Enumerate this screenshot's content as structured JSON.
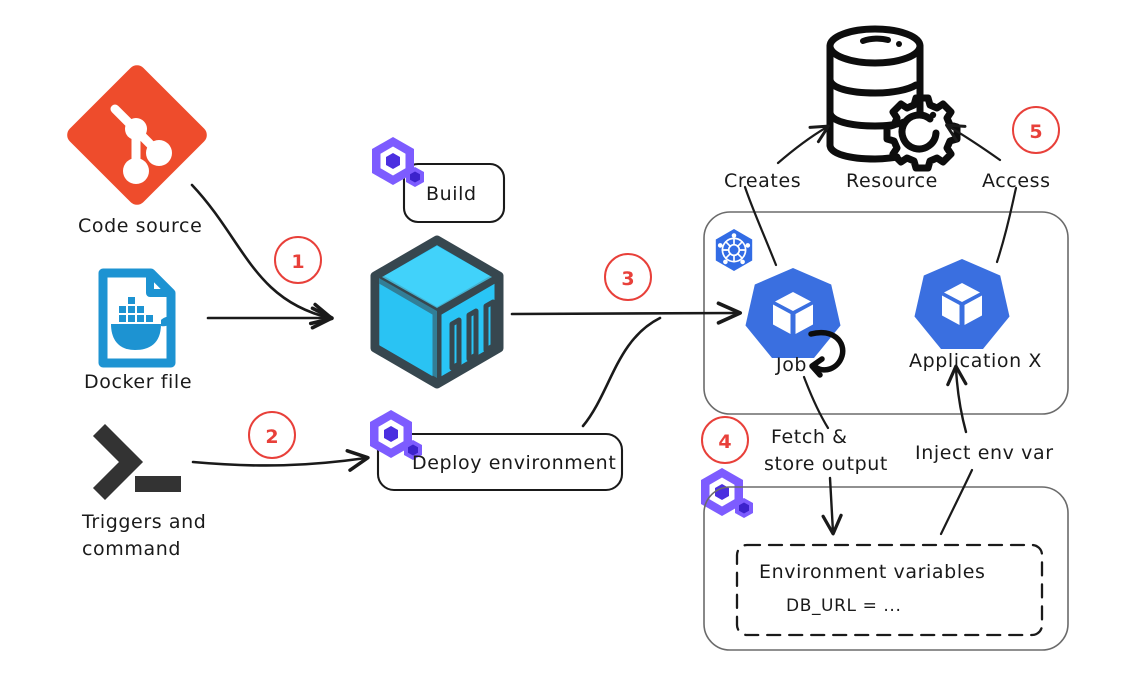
{
  "diagram": {
    "title": "CI/CD deployment pipeline diagram",
    "colors": {
      "git_orange": "#ee4c2c",
      "docker_blue": "#1d93d2",
      "terminal_dark": "#333333",
      "container_cyan": "#29c5f6",
      "container_outline": "#37474f",
      "kubernetes_blue": "#326ce5",
      "pod_blue": "#3a6fe0",
      "dagger_purple": "#6d4aff",
      "step_red": "#e8403a",
      "ink": "#1a1a1a",
      "box_gray": "#6b6b6b"
    }
  },
  "sources": [
    {
      "id": "code-source",
      "label": "Code source",
      "icon": "git-icon"
    },
    {
      "id": "docker-file",
      "label": "Docker file",
      "icon": "docker-file-icon"
    },
    {
      "id": "triggers-command",
      "label_line1": "Triggers and",
      "label_line2": "command",
      "icon": "terminal-icon"
    }
  ],
  "steps": [
    {
      "number": "1"
    },
    {
      "number": "2"
    },
    {
      "number": "3"
    },
    {
      "number": "4"
    },
    {
      "number": "5"
    }
  ],
  "pipeline": {
    "build_box": {
      "label": "Build",
      "icon": "dagger-icon"
    },
    "container": {
      "icon": "container-cube-icon"
    },
    "deploy_box": {
      "label": "Deploy environment",
      "icon": "dagger-icon"
    }
  },
  "resource": {
    "label": "Resource",
    "icon": "database-gear-icon",
    "creates_label": "Creates",
    "access_label": "Access"
  },
  "cluster": {
    "icon": "kubernetes-icon",
    "workloads": [
      {
        "id": "job",
        "label": "Job",
        "icon": "pod-icon",
        "badge": "loop-arrow-icon"
      },
      {
        "id": "application-x",
        "label": "Application X",
        "icon": "pod-icon"
      }
    ]
  },
  "env_section": {
    "icon": "dagger-icon",
    "fetch_label_line1": "Fetch &",
    "fetch_label_line2": "store output",
    "inject_label": "Inject env var",
    "dashed_box": {
      "title": "Environment variables",
      "entry": "DB_URL = ..."
    }
  }
}
